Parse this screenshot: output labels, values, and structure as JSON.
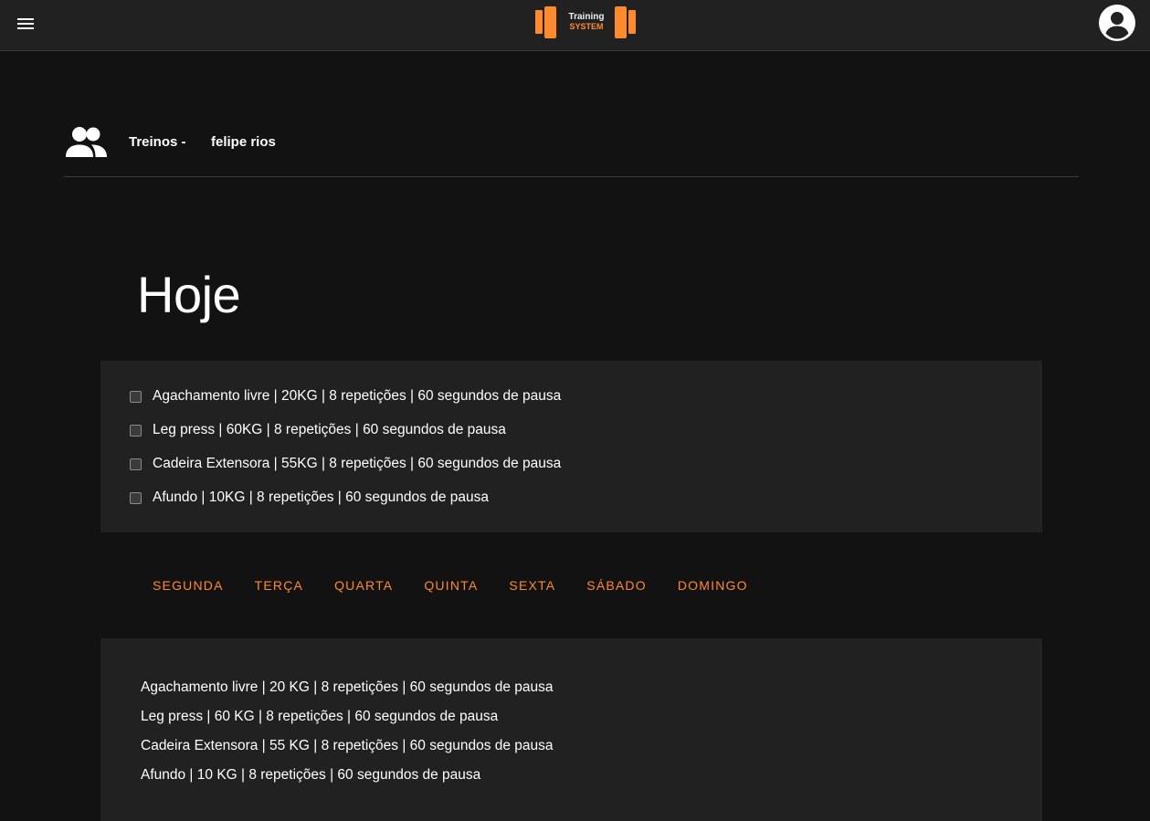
{
  "app": {
    "logo_line1": "Training",
    "logo_line2": "SYSTEM"
  },
  "icons": {
    "menu": "menu-icon",
    "account": "account-circle-icon",
    "users": "users-icon"
  },
  "colors": {
    "accent": "#ff8a2c",
    "background": "#121212",
    "surface": "#212121"
  },
  "header": {
    "title": "Treinos -",
    "user": "felipe rios"
  },
  "today": {
    "heading": "Hoje",
    "exercises": [
      {
        "label": "Agachamento livre | 20KG | 8 repetições | 60 segundos de pausa",
        "checked": false
      },
      {
        "label": "Leg press | 60KG | 8 repetições | 60 segundos de pausa",
        "checked": false
      },
      {
        "label": "Cadeira Extensora | 55KG | 8 repetições | 60 segundos de pausa",
        "checked": false
      },
      {
        "label": "Afundo | 10KG | 8 repetições | 60 segundos de pausa",
        "checked": false
      }
    ]
  },
  "week_tabs": [
    "SEGUNDA",
    "TERÇA",
    "QUARTA",
    "QUINTA",
    "SEXTA",
    "SÁBADO",
    "DOMINGO"
  ],
  "week_plan": [
    "Agachamento livre | 20 KG | 8 repetições | 60 segundos de pausa",
    "Leg press | 60 KG | 8 repetições | 60 segundos de pausa",
    "Cadeira Extensora | 55 KG | 8 repetições | 60 segundos de pausa",
    "Afundo | 10 KG | 8 repetições | 60 segundos de pausa"
  ]
}
